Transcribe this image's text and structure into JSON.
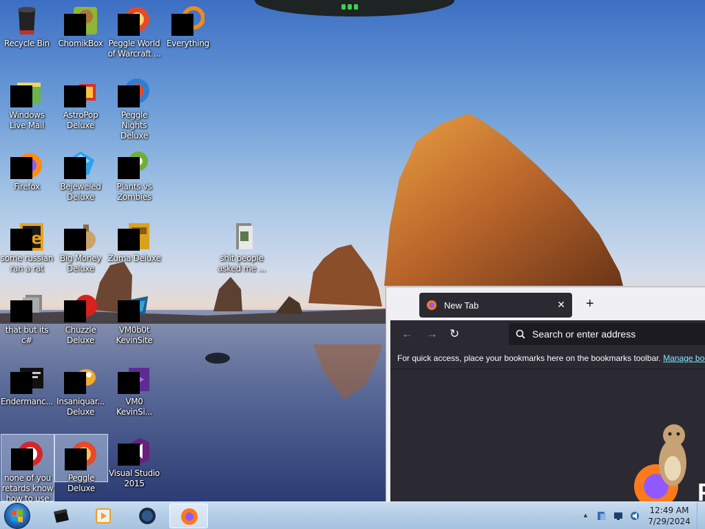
{
  "desktop": {
    "icons": [
      {
        "label": "Recycle Bin",
        "icon": "recycle-bin-icon"
      },
      {
        "label": "ChomikBox",
        "icon": "chomikbox-icon"
      },
      {
        "label": "Peggle World of Warcraft ...",
        "icon": "peggle-wow-icon"
      },
      {
        "label": "Everything",
        "icon": "everything-search-icon"
      },
      {
        "label": "Windows Live Mail",
        "icon": "windows-live-mail-icon"
      },
      {
        "label": "AstroPop Deluxe",
        "icon": "astropop-icon"
      },
      {
        "label": "Peggle Nights Deluxe",
        "icon": "peggle-nights-icon"
      },
      {
        "label": "Firefox",
        "icon": "firefox-icon"
      },
      {
        "label": "Bejeweled Deluxe",
        "icon": "bejeweled-icon"
      },
      {
        "label": "Plants vs Zombies",
        "icon": "plants-vs-zombies-icon"
      },
      {
        "label": "some russian ran a rat",
        "icon": "exe-file-icon"
      },
      {
        "label": "Big Money Deluxe",
        "icon": "big-money-icon"
      },
      {
        "label": "Zuma Deluxe",
        "icon": "zuma-icon"
      },
      {
        "label": "shit people asked me ...",
        "icon": "folder-icon"
      },
      {
        "label": "that but its c#",
        "icon": "stacked-files-icon"
      },
      {
        "label": "Chuzzle Deluxe",
        "icon": "chuzzle-icon"
      },
      {
        "label": "VM0b0t KevinSite",
        "icon": "vm-shortcut-icon"
      },
      {
        "label": "Endermanc...",
        "icon": "console-app-icon"
      },
      {
        "label": "Insaniquar... Deluxe",
        "icon": "insaniquarium-icon"
      },
      {
        "label": "VM0 KevinSi...",
        "icon": "visual-studio-project-icon"
      },
      {
        "label": "none of you retards know how to use",
        "icon": "peggle-shortcut-icon"
      },
      {
        "label": "Peggle Deluxe",
        "icon": "peggle-deluxe-icon"
      },
      {
        "label": "Visual Studio 2015",
        "icon": "visual-studio-icon"
      }
    ]
  },
  "browser": {
    "tab_title": "New Tab",
    "tab_close": "✕",
    "new_tab": "+",
    "back": "←",
    "forward": "→",
    "reload": "↻",
    "search_placeholder": "Search or enter address",
    "bookmarks_message": "For quick access, place your bookmarks here on the bookmarks toolbar.",
    "bookmarks_link": "Manage boo",
    "wordmark": "F",
    "colors": {
      "chrome": "#2b2a33",
      "link": "#80ebff",
      "tabstrip": "#f0f0f4"
    }
  },
  "taskbar": {
    "pinned": [
      {
        "name": "explorer",
        "icon": "black-box-icon"
      },
      {
        "name": "media-player",
        "icon": "media-player-icon"
      },
      {
        "name": "globe-app",
        "icon": "globe-icon"
      },
      {
        "name": "firefox",
        "icon": "firefox-icon",
        "active": true
      }
    ],
    "tray_chevron": "▲",
    "clock": {
      "time": "12:49 AM",
      "date": "7/29/2024"
    }
  }
}
